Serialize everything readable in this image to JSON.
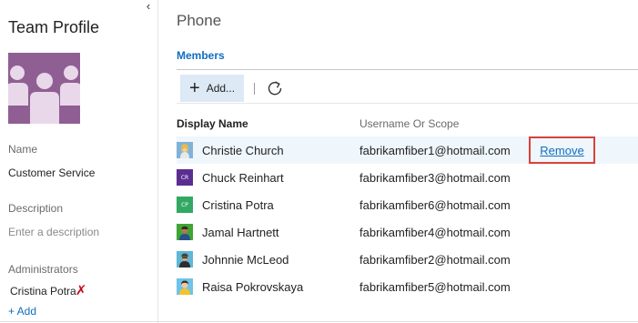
{
  "sidebar": {
    "collapse_glyph": "‹",
    "title": "Team Profile",
    "avatar_icon": "team-icon",
    "avatar_color": "#8f5f94",
    "name_label": "Name",
    "name_value": "Customer Service",
    "description_label": "Description",
    "description_placeholder": "Enter a description",
    "administrators_label": "Administrators",
    "administrators": [
      {
        "name": "Cristina Potra",
        "remove_glyph": "✗"
      }
    ],
    "add_admin_label": "+ Add"
  },
  "main": {
    "title": "Phone",
    "section_title": "Members",
    "toolbar": {
      "add_plus": "+",
      "add_label": "Add...",
      "refresh_icon": "refresh-icon"
    },
    "columns": {
      "display_name": "Display Name",
      "username": "Username Or Scope"
    },
    "members": [
      {
        "name": "Christie Church",
        "user": "fabrikamfiber1@hotmail.com",
        "avatar": "photo",
        "selected": true
      },
      {
        "name": "Chuck Reinhart",
        "user": "fabrikamfiber3@hotmail.com",
        "avatar": "initials",
        "initials": "CR",
        "color": "#5c2d91"
      },
      {
        "name": "Cristina Potra",
        "user": "fabrikamfiber6@hotmail.com",
        "avatar": "initials",
        "initials": "CP",
        "color": "#33a863"
      },
      {
        "name": "Jamal Hartnett",
        "user": "fabrikamfiber4@hotmail.com",
        "avatar": "photo"
      },
      {
        "name": "Johnnie McLeod",
        "user": "fabrikamfiber2@hotmail.com",
        "avatar": "photo"
      },
      {
        "name": "Raisa Pokrovskaya",
        "user": "fabrikamfiber5@hotmail.com",
        "avatar": "photo"
      }
    ],
    "remove_label": "Remove"
  },
  "colors": {
    "accent": "#106ebe",
    "highlight_border": "#d9413a",
    "selected_row": "#eff6fc",
    "add_button_bg": "#dde9f5"
  }
}
